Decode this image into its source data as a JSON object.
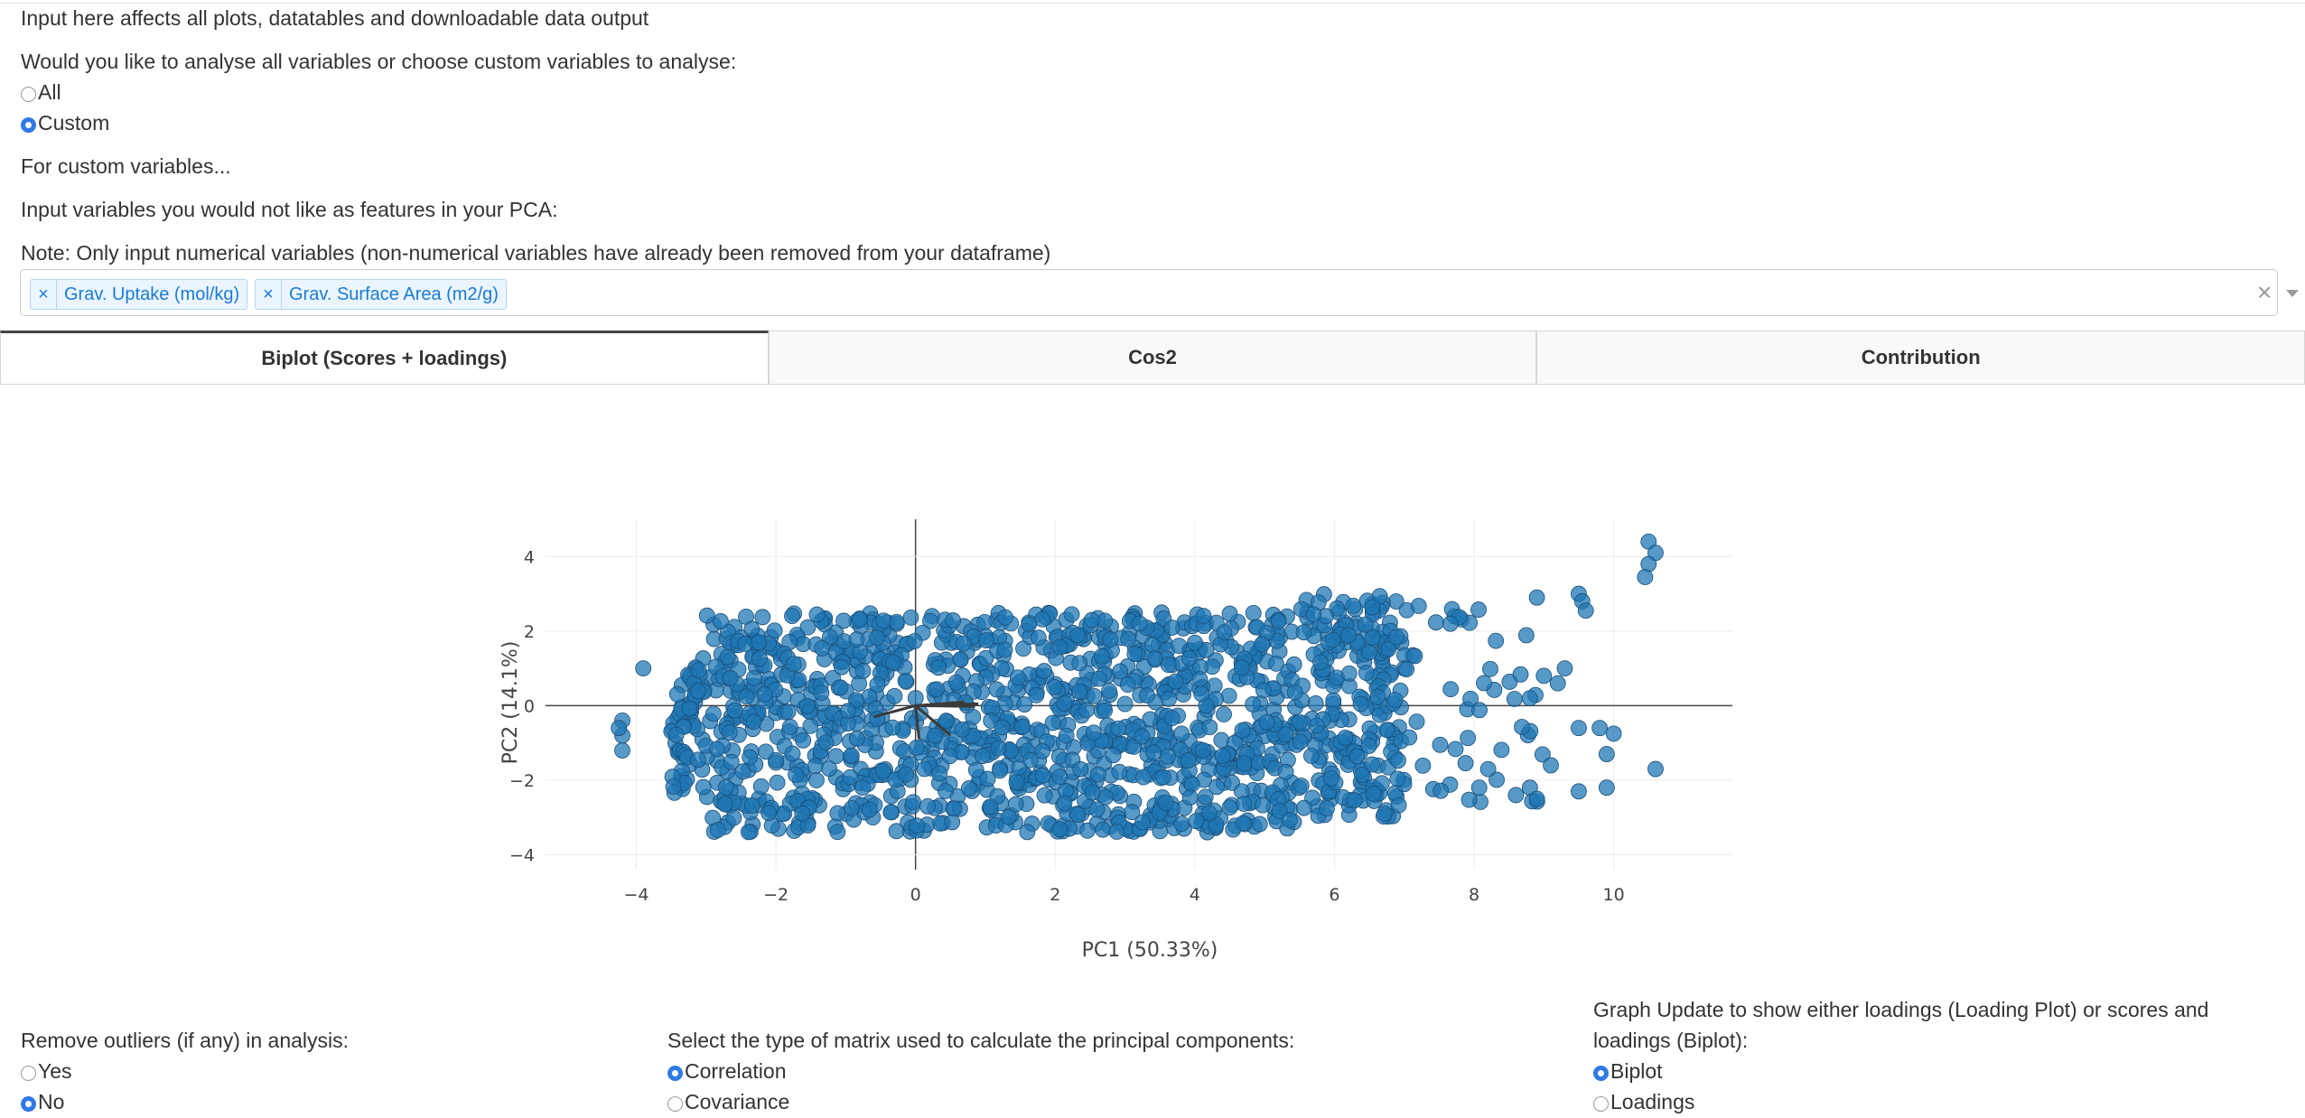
{
  "header": {
    "intro": "Input here affects all plots, datatables and downloadable data output",
    "question": "Would you like to analyse all variables or choose custom variables to analyse:",
    "options": [
      "All",
      "Custom"
    ],
    "selected": "Custom",
    "custom_heading": "For custom variables...",
    "exclude_prompt": "Input variables you would not like as features in your PCA:",
    "note": "Note: Only input numerical variables (non-numerical variables have already been removed from your dataframe)"
  },
  "multiselect": {
    "chips": [
      "Grav. Uptake (mol/kg)",
      "Grav. Surface Area (m2/g)"
    ],
    "remove_glyph": "×",
    "clear_glyph": "×"
  },
  "tabs": [
    {
      "label": "Biplot (Scores + loadings)",
      "active": true
    },
    {
      "label": "Cos2",
      "active": false
    },
    {
      "label": "Contribution",
      "active": false
    }
  ],
  "chart_data": {
    "type": "scatter",
    "xlabel": "PC1 (50.33%)",
    "ylabel": "PC2 (14.1%)",
    "xlim": [
      -5.3,
      11.7
    ],
    "ylim": [
      -4.4,
      5.0
    ],
    "xticks": [
      -4,
      -2,
      0,
      2,
      4,
      6,
      8,
      10
    ],
    "yticks": [
      -4,
      -2,
      0,
      2,
      4
    ],
    "grid": true,
    "marker_color": "#1f77b4",
    "series": [
      {
        "type": "scatter-cloud",
        "approx_extent": {
          "x": [
            -3.5,
            7.0
          ],
          "y": [
            -3.6,
            3.3
          ]
        },
        "outlier_points": [
          [
            -4.2,
            -0.4
          ],
          [
            -4.2,
            -0.8
          ],
          [
            -4.2,
            -1.2
          ],
          [
            -4.25,
            -0.6
          ],
          [
            -3.9,
            1.0
          ],
          [
            10.5,
            4.4
          ],
          [
            10.6,
            4.1
          ],
          [
            10.5,
            3.8
          ],
          [
            10.45,
            3.45
          ],
          [
            9.5,
            3.0
          ],
          [
            9.55,
            2.8
          ],
          [
            9.6,
            2.55
          ],
          [
            8.9,
            2.9
          ],
          [
            9.3,
            1.0
          ],
          [
            9.2,
            0.6
          ],
          [
            9.0,
            0.8
          ],
          [
            8.8,
            0.2
          ],
          [
            9.5,
            -0.6
          ],
          [
            9.8,
            -0.6
          ],
          [
            10.0,
            -0.75
          ],
          [
            10.6,
            -1.7
          ],
          [
            9.9,
            -1.3
          ],
          [
            9.1,
            -1.6
          ],
          [
            9.5,
            -2.3
          ],
          [
            9.9,
            -2.2
          ],
          [
            8.8,
            -2.2
          ],
          [
            8.6,
            -2.4
          ],
          [
            8.9,
            -2.5
          ]
        ]
      }
    ],
    "loadings": [
      {
        "x": 0.9,
        "y": 0.05
      },
      {
        "x": 0.85,
        "y": -0.02
      },
      {
        "x": -0.6,
        "y": -0.3
      },
      {
        "x": 0.5,
        "y": -0.8
      },
      {
        "x": 0.05,
        "y": -0.9
      },
      {
        "x": 0.7,
        "y": 0.1
      }
    ]
  },
  "footer": {
    "outliers": {
      "label": "Remove outliers (if any) in analysis:",
      "options": [
        "Yes",
        "No"
      ],
      "selected": "No"
    },
    "matrix": {
      "label": "Select the type of matrix used to calculate the principal components:",
      "options": [
        "Correlation",
        "Covariance"
      ],
      "selected": "Correlation"
    },
    "graph": {
      "label_line1": "Graph Update to show either loadings (Loading Plot) or scores and",
      "label_line2": "loadings (Biplot):",
      "options": [
        "Biplot",
        "Loadings"
      ],
      "selected": "Biplot"
    }
  }
}
